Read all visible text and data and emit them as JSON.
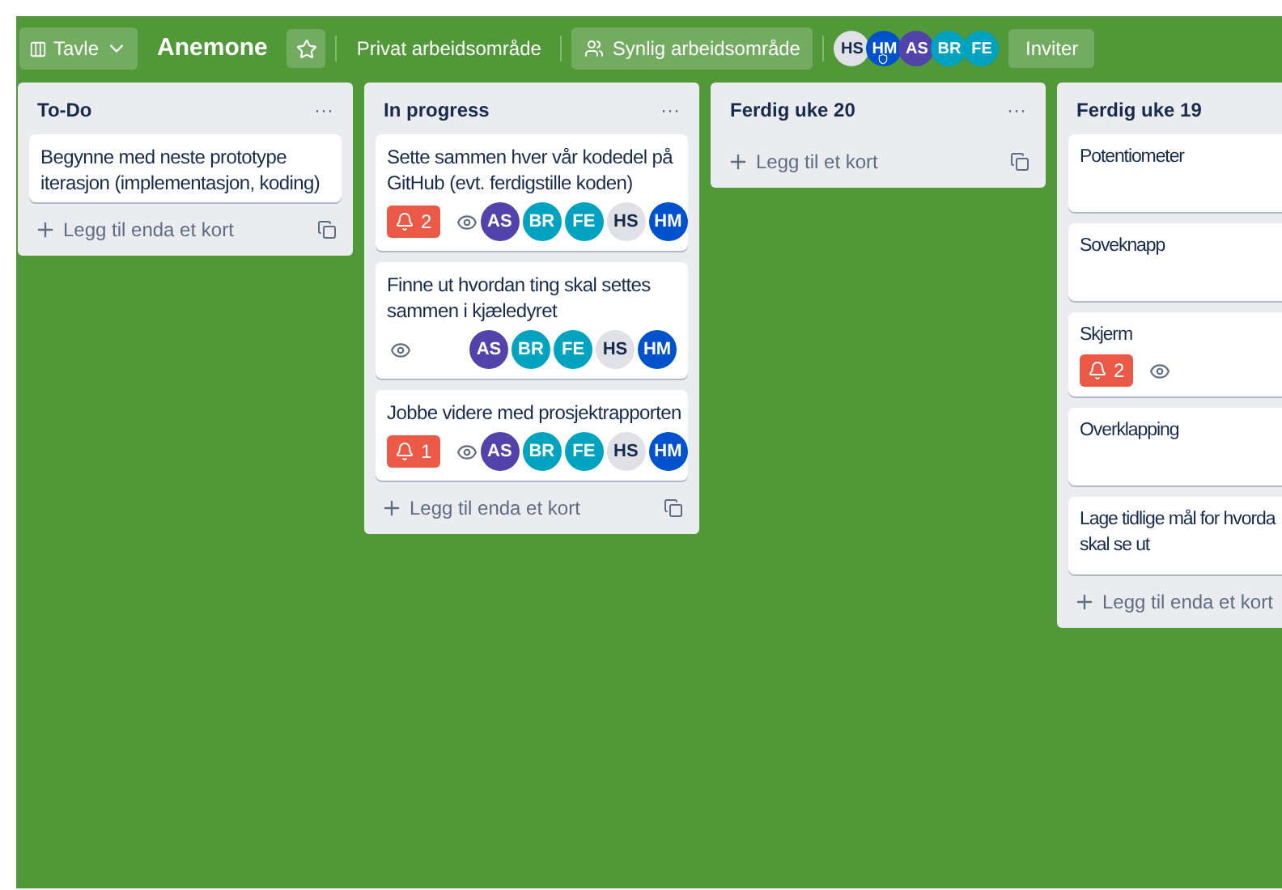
{
  "header": {
    "view_button": "Tavle",
    "board_title": "Anemone",
    "workspace": "Privat arbeidsområde",
    "visibility": "Synlig arbeidsområde",
    "members": [
      {
        "initials": "HS",
        "color": "#dfe1e6",
        "admin": false
      },
      {
        "initials": "HM",
        "color": "#0052cc",
        "admin": true
      },
      {
        "initials": "AS",
        "color": "#5243aa",
        "admin": false
      },
      {
        "initials": "BR",
        "color": "#00a3bf",
        "admin": false
      },
      {
        "initials": "FE",
        "color": "#00a3bf",
        "admin": false
      }
    ],
    "invite_button": "Inviter"
  },
  "lists": [
    {
      "title": "To-Do",
      "menu": "···",
      "cards": [
        {
          "lines": [
            "Begynne med neste prototype",
            "iterasjon (implementasjon, koding)"
          ]
        }
      ],
      "add_card": "Legg til enda et kort"
    },
    {
      "title": "In progress",
      "menu": "···",
      "cards": [
        {
          "lines": [
            "Sette sammen hver vår kodedel på",
            "GitHub (evt. ferdigstille koden)"
          ],
          "notifications": "2",
          "watching": true,
          "members": [
            {
              "initials": "AS",
              "color": "#5243aa"
            },
            {
              "initials": "BR",
              "color": "#00a3bf"
            },
            {
              "initials": "FE",
              "color": "#00a3bf"
            },
            {
              "initials": "HS",
              "color": "#dfe1e6"
            },
            {
              "initials": "HM",
              "color": "#0052cc"
            }
          ]
        },
        {
          "lines": [
            "Finne ut hvordan ting skal settes",
            "sammen i kjæledyret"
          ],
          "watching": true,
          "members": [
            {
              "initials": "AS",
              "color": "#5243aa"
            },
            {
              "initials": "BR",
              "color": "#00a3bf"
            },
            {
              "initials": "FE",
              "color": "#00a3bf"
            },
            {
              "initials": "HS",
              "color": "#dfe1e6"
            },
            {
              "initials": "HM",
              "color": "#0052cc"
            }
          ]
        },
        {
          "lines": [
            "Jobbe videre med prosjektrapporten"
          ],
          "notifications": "1",
          "watching": true,
          "members": [
            {
              "initials": "AS",
              "color": "#5243aa"
            },
            {
              "initials": "BR",
              "color": "#00a3bf"
            },
            {
              "initials": "FE",
              "color": "#00a3bf"
            },
            {
              "initials": "HS",
              "color": "#dfe1e6"
            },
            {
              "initials": "HM",
              "color": "#0052cc"
            }
          ]
        }
      ],
      "add_card": "Legg til enda et kort"
    },
    {
      "title": "Ferdig uke 20",
      "menu": "···",
      "add_card": "Legg til et kort"
    },
    {
      "title": "Ferdig uke 19",
      "cards": [
        {
          "lines": [
            "Potentiometer"
          ]
        },
        {
          "lines": [
            "Soveknapp"
          ]
        },
        {
          "lines": [
            "Skjerm"
          ],
          "notifications": "2",
          "watching": true
        },
        {
          "lines": [
            "Overklapping"
          ]
        },
        {
          "lines": [
            "Lage tidlige mål for hvorda",
            "skal se ut"
          ]
        }
      ],
      "add_card": "Legg til enda et kort"
    }
  ]
}
